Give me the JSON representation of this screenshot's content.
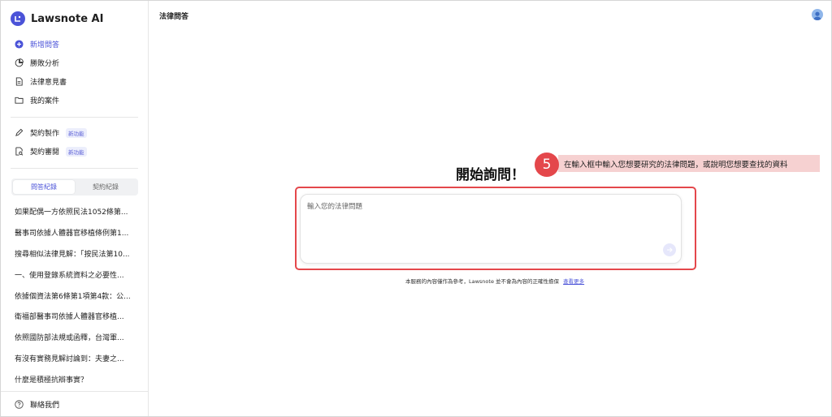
{
  "app": {
    "name": "Lawsnote AI"
  },
  "colors": {
    "accent": "#4b53d8",
    "highlight": "#e4474b",
    "callout_bg": "#f6d1d1"
  },
  "sidebar": {
    "nav": [
      {
        "label": "新增問答",
        "icon": "plus-circle-icon"
      },
      {
        "label": "勝敗分析",
        "icon": "pie-chart-icon"
      },
      {
        "label": "法律意見書",
        "icon": "document-icon"
      },
      {
        "label": "我的案件",
        "icon": "folder-icon"
      }
    ],
    "tools": [
      {
        "label": "契約製作",
        "badge": "新功能",
        "icon": "pen-icon"
      },
      {
        "label": "契約審閱",
        "badge": "新功能",
        "icon": "document-search-icon"
      }
    ],
    "tabs": [
      "問答紀錄",
      "契約紀錄"
    ],
    "history": [
      "如果配偶一方依照民法1052條第...",
      "醫事司依據人體器官移植條例第1...",
      "搜尋相似法律見解：「按民法第10...",
      "一、使用登錄系統資料之必要性...",
      "依據個資法第6條第1項第4款：公...",
      "衛福部醫事司依據人體器官移植...",
      "依照國防部法規或函釋，台灣軍...",
      "有沒有實務見解討論到：夫妻之...",
      "什麼是積極抗辯事實？"
    ],
    "footer": {
      "label": "聯絡我們",
      "icon": "help-circle-icon"
    }
  },
  "main": {
    "page_title": "法律問答",
    "heading": "開始詢問！",
    "step": {
      "number": "5",
      "text": "在輸入框中輸入您想要研究的法律問題，或說明您想要查找的資料"
    },
    "input": {
      "placeholder": "輸入您的法律問題",
      "value": ""
    },
    "disclaimer": {
      "text": "本服務的內容僅作為參考，Lawsnote 並不會為內容的正確性擔保",
      "link": "查看更多"
    }
  }
}
